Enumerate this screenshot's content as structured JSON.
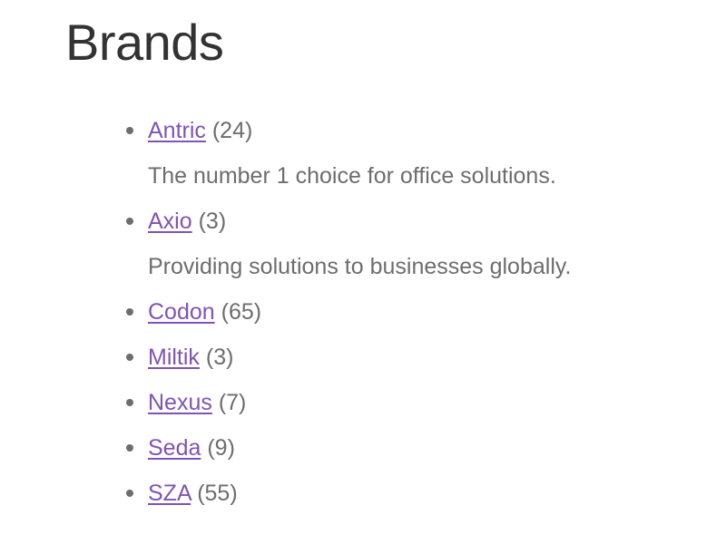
{
  "page_title": "Brands",
  "colors": {
    "link": "#7f54b3",
    "text": "#6d6d6d",
    "heading": "#333333"
  },
  "brands": [
    {
      "name": "Antric",
      "count": "(24)",
      "description": "The number 1 choice for office solutions."
    },
    {
      "name": "Axio",
      "count": "(3)",
      "description": "Providing solutions to businesses globally."
    },
    {
      "name": "Codon",
      "count": "(65)"
    },
    {
      "name": "Miltik",
      "count": "(3)"
    },
    {
      "name": "Nexus",
      "count": "(7)"
    },
    {
      "name": "Seda",
      "count": "(9)"
    },
    {
      "name": "SZA",
      "count": "(55)"
    }
  ]
}
